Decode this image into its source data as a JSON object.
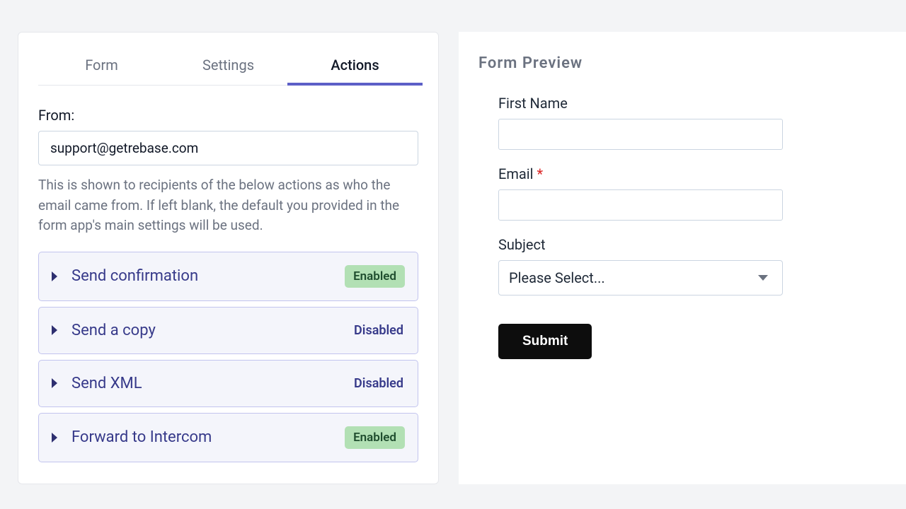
{
  "tabs": {
    "form": "Form",
    "settings": "Settings",
    "actions": "Actions"
  },
  "from": {
    "label": "From:",
    "value": "support@getrebase.com",
    "help": "This is shown to recipients of the below actions as who the email came from. If left blank, the default you provided in the form app's main settings will be used."
  },
  "status_labels": {
    "enabled": "Enabled",
    "disabled": "Disabled"
  },
  "actions": [
    {
      "title": "Send confirmation",
      "enabled": true
    },
    {
      "title": "Send a copy",
      "enabled": false
    },
    {
      "title": "Send XML",
      "enabled": false
    },
    {
      "title": "Forward to Intercom",
      "enabled": true
    }
  ],
  "preview": {
    "heading": "Form Preview",
    "first_name_label": "First Name",
    "email_label": "Email",
    "subject_label": "Subject",
    "subject_placeholder": "Please Select...",
    "submit": "Submit"
  }
}
